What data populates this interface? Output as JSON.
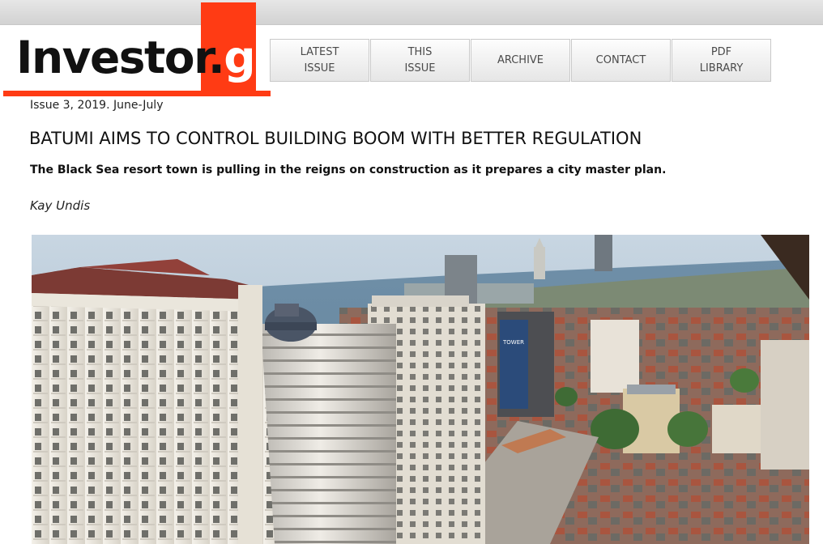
{
  "header": {
    "logo": {
      "main": "Investor.",
      "suffix": "ge"
    },
    "nav": [
      {
        "label": "LATEST\nISSUE"
      },
      {
        "label": "THIS\nISSUE"
      },
      {
        "label": "ARCHIVE"
      },
      {
        "label": "CONTACT"
      },
      {
        "label": "PDF\nLIBRARY"
      }
    ]
  },
  "article": {
    "issue": "Issue 3, 2019. June-July",
    "title": "BATUMI AIMS TO CONTROL BUILDING BOOM WITH BETTER REGULATION",
    "subtitle": "The Black Sea resort town is pulling in the reigns on construction as it prepares a city master plan.",
    "author": "Kay Undis",
    "billboard_text": "TOWER"
  },
  "colors": {
    "brand_red": "#ff3b14",
    "nav_text": "#4a4a4a"
  }
}
